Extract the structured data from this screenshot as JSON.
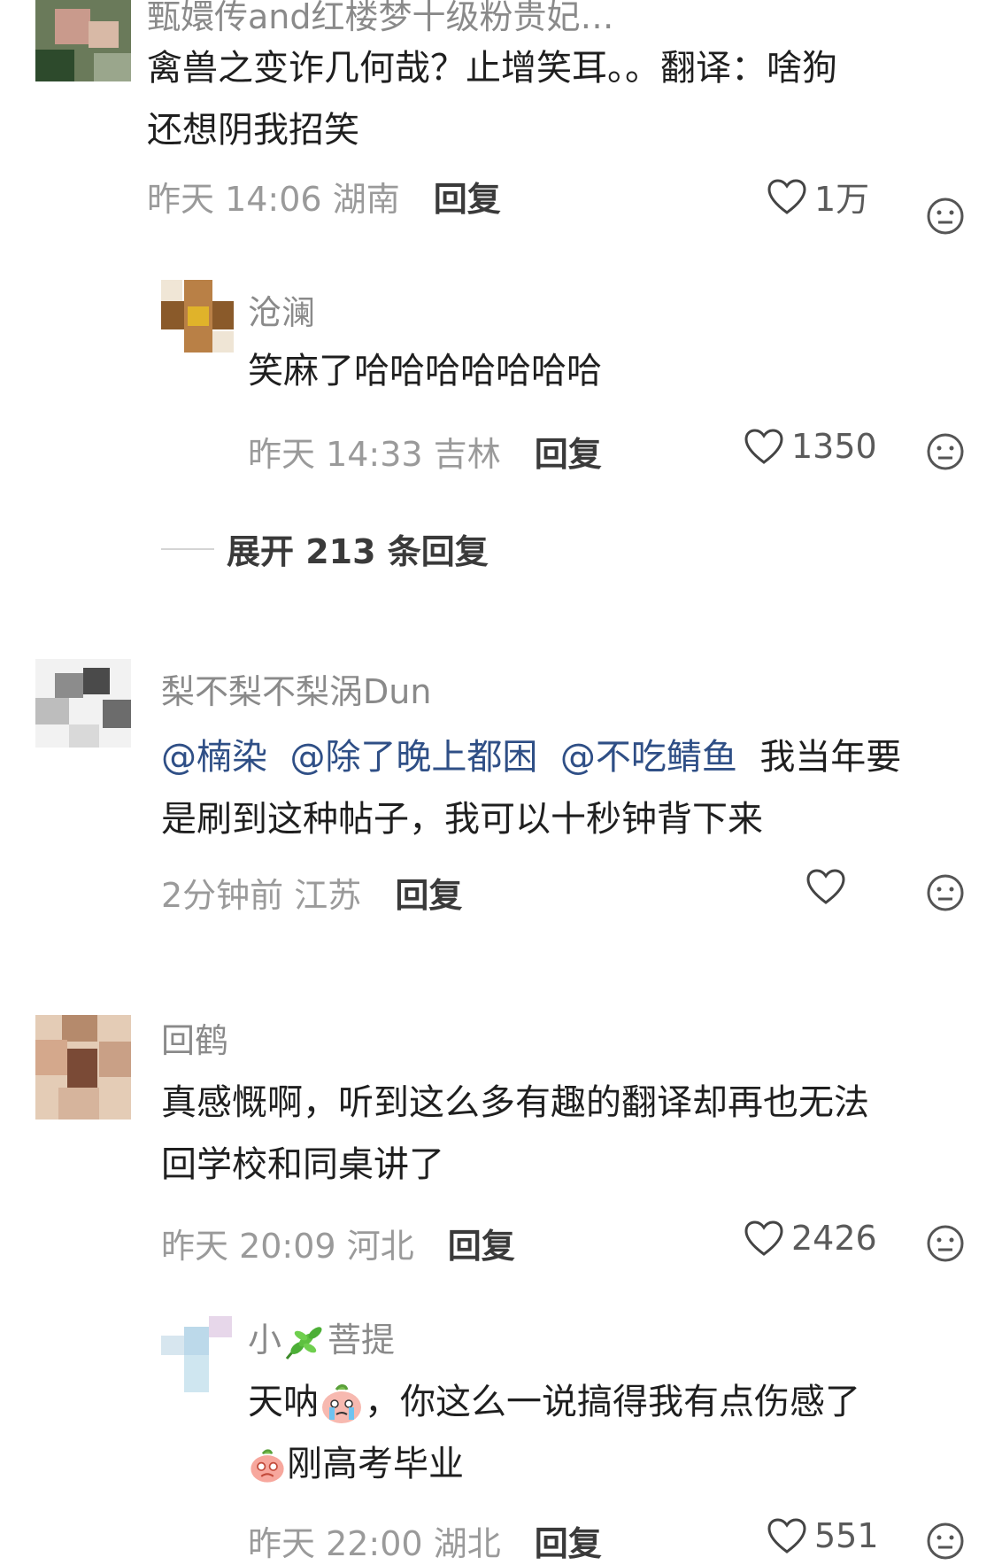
{
  "comments": [
    {
      "username": "甄嬛传and红楼梦十级粉贵妃…",
      "text": "禽兽之变诈几何哉？止增笑耳。。翻译：啥狗还想阴我招笑",
      "line1": "禽兽之变诈几何哉？止增笑耳。。翻译：啥狗",
      "line2": "还想阴我招笑",
      "time": "昨天 14:06",
      "location": "湖南",
      "reply_label": "回复",
      "likes": "1万"
    },
    {
      "username": "沧澜",
      "text": "笑麻了哈哈哈哈哈哈哈",
      "time": "昨天 14:33",
      "location": "吉林",
      "reply_label": "回复",
      "likes": "1350"
    },
    {
      "expand_label": "展开 213 条回复"
    },
    {
      "username": "梨不梨不梨涡Dun",
      "mentions": [
        "@楠染",
        "@除了晚上都困",
        "@不吃鲭鱼"
      ],
      "line1_rest": "我当年要",
      "line2": "是刷到这种帖子，我可以十秒钟背下来",
      "time": "2分钟前",
      "location": "江苏",
      "reply_label": "回复",
      "likes": ""
    },
    {
      "username": "回鹤",
      "line1": "真感慨啊，听到这么多有趣的翻译却再也无法",
      "line2": "回学校和同桌讲了",
      "time": "昨天 20:09",
      "location": "河北",
      "reply_label": "回复",
      "likes": "2426"
    },
    {
      "username_pre": "小",
      "username_post": "菩提",
      "line1_pre": "天呐",
      "line1_post": "，你这么一说搞得我有点伤感了",
      "line2": "刚高考毕业",
      "time": "昨天 22:00",
      "location": "湖北",
      "reply_label": "回复",
      "likes": "551"
    }
  ],
  "icons": {
    "like": "heart-outline-icon",
    "dislike": "neutral-face-icon",
    "leaf": "herb-leaf-emoji",
    "crying": "crying-peach-emoji"
  },
  "colors": {
    "mention": "#2f4f86",
    "meta": "#9a9a9a",
    "username": "#8a8a8a"
  }
}
